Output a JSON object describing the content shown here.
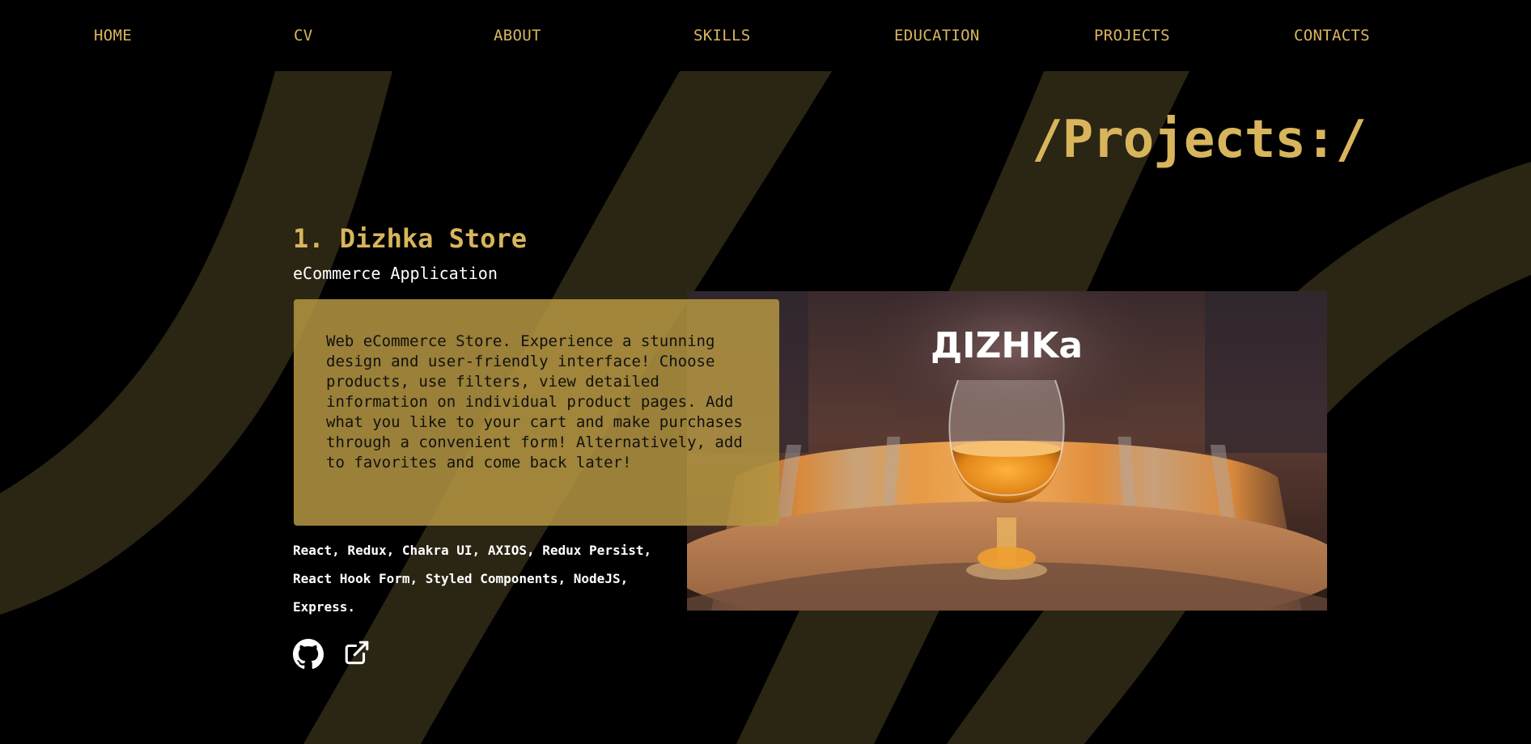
{
  "nav": {
    "items": [
      "HOME",
      "CV",
      "ABOUT",
      "SKILLS",
      "EDUCATION",
      "PROJECTS",
      "CONTACTS"
    ]
  },
  "page": {
    "heading": "/Projects:/"
  },
  "project": {
    "title": "1. Dizhka Store",
    "subtitle": "eCommerce Application",
    "description": "Web eCommerce Store. Experience a stunning design and user-friendly interface! Choose products, use filters, view detailed information on individual product pages. Add what you like to your cart and make purchases through a convenient form! Alternatively, add to favorites and come back later!",
    "stack": "React, Redux, Chakra UI, AXIOS, Redux Persist, React Hook Form, Styled Components, NodeJS, Express.",
    "image_logo_text": "ДIZHKa",
    "github_icon": "github-icon",
    "external_link_icon": "external-link-icon"
  },
  "colors": {
    "accent": "#d8b55c",
    "background": "#000000",
    "stripe": "#2b2513",
    "description_box": "#b59642"
  }
}
